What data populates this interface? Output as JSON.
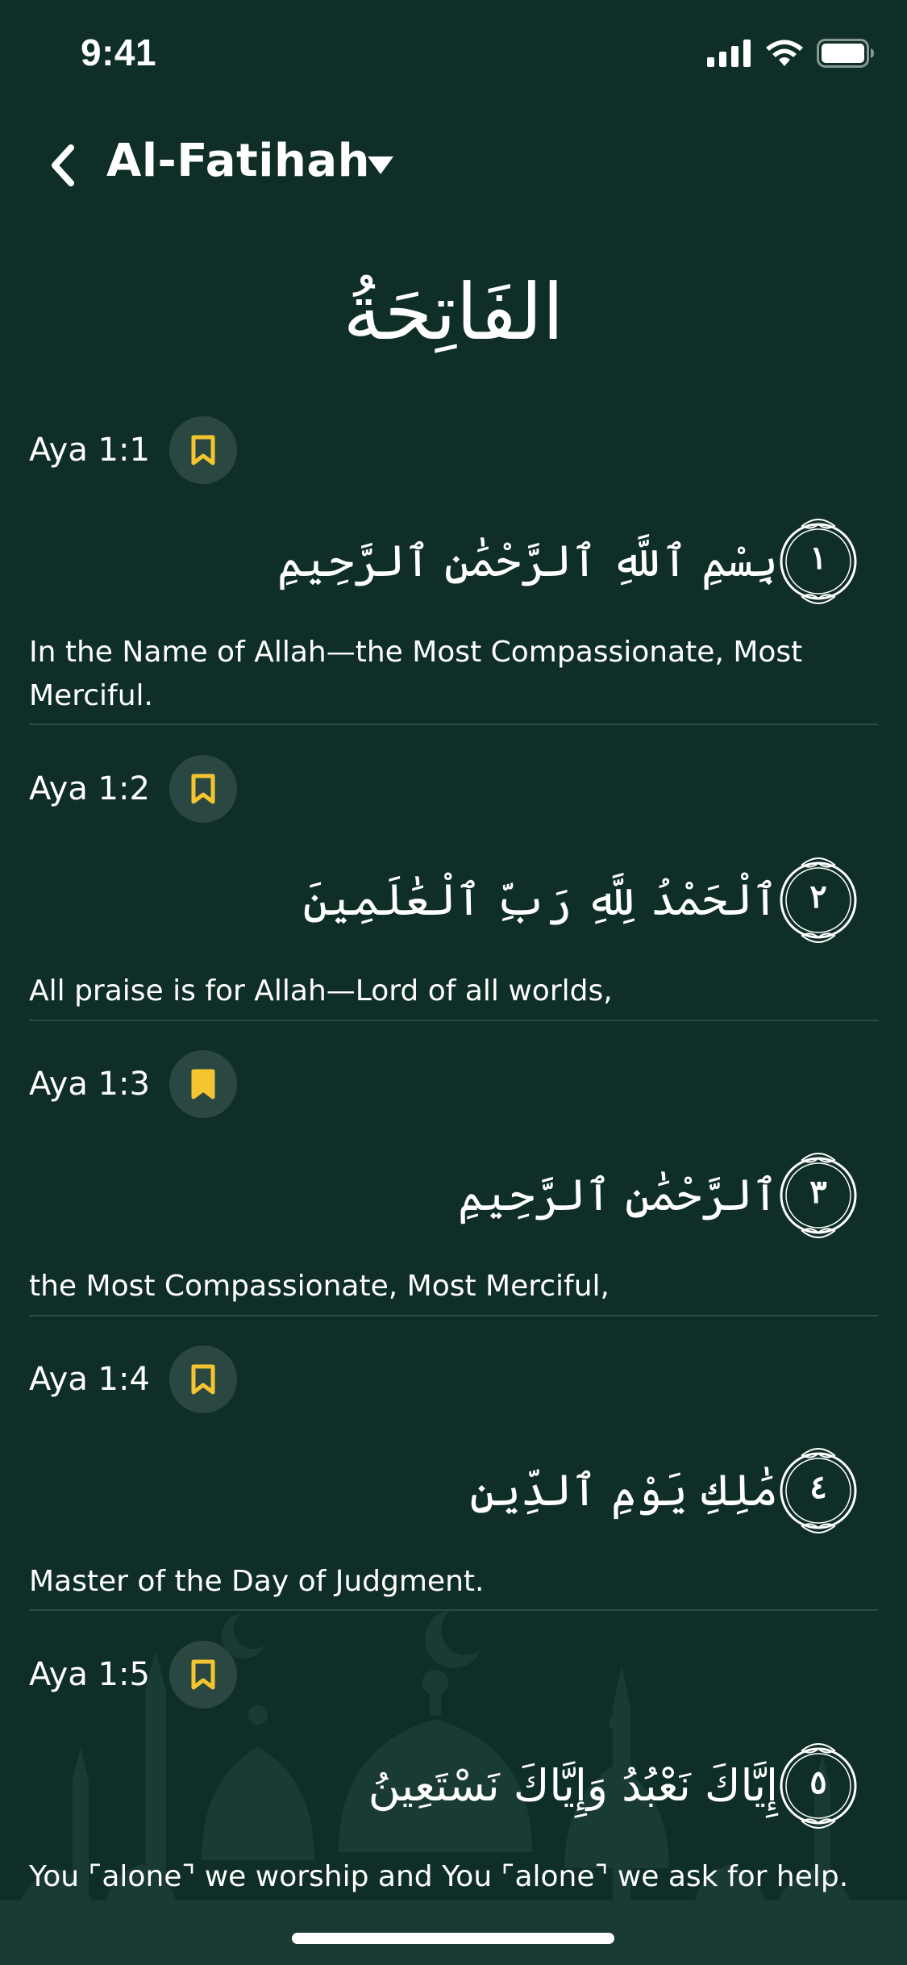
{
  "status_bar": {
    "time": "9:41"
  },
  "header": {
    "title": "Al-Fatihah",
    "back_icon": "chevron-left-icon",
    "dropdown_icon": "caret-down-icon"
  },
  "surah": {
    "arabic_title": "الفَاتِحَةُ"
  },
  "colors": {
    "background": "#0f2e27",
    "bookmark_accent": "#f5c431",
    "bookmark_button_bg": "#2b4741",
    "divider": "#2a4a43"
  },
  "ayas": [
    {
      "label": "Aya 1:1",
      "bookmarked": false,
      "arabic": "بِسْمِ ٱللَّهِ ٱلرَّحْمَٰنِ ٱلرَّحِيمِ",
      "number": "١",
      "translation": "In the Name of Allah—the Most Compassionate, Most Merciful."
    },
    {
      "label": "Aya 1:2",
      "bookmarked": false,
      "arabic": "ٱلْحَمْدُ لِلَّهِ رَبِّ ٱلْعَٰلَمِينَ",
      "number": "٢",
      "translation": "All praise is for Allah—Lord of all worlds,"
    },
    {
      "label": "Aya 1:3",
      "bookmarked": true,
      "arabic": "ٱلرَّحْمَٰنِ ٱلرَّحِيمِ",
      "number": "٣",
      "translation": "the Most Compassionate, Most Merciful,"
    },
    {
      "label": "Aya 1:4",
      "bookmarked": false,
      "arabic": "مَٰلِكِ يَوْمِ ٱلدِّينِ",
      "number": "٤",
      "translation": "Master of the Day of Judgment."
    },
    {
      "label": "Aya 1:5",
      "bookmarked": false,
      "arabic": "إِيَّاكَ نَعْبُدُ وَإِيَّاكَ نَسْتَعِينُ",
      "number": "٥",
      "translation": "You ⌜alone⌝ we worship and You ⌜alone⌝ we ask for help."
    }
  ]
}
